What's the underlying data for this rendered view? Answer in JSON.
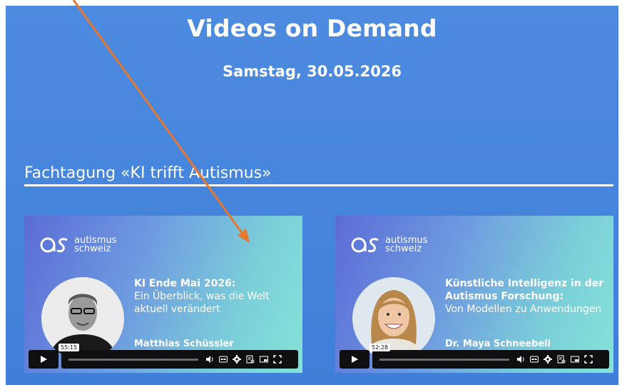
{
  "page": {
    "title": "Videos on Demand",
    "date": "Samstag, 30.05.2026",
    "section_title": "Fachtagung «KI trifft Autismus»"
  },
  "videos": [
    {
      "logo_line1": "autismus",
      "logo_line2": "schweiz",
      "headline": "KI Ende Mai 2026:",
      "subtitle_line1": "Ein Überblick, was die Welt",
      "subtitle_line2": "aktuell verändert",
      "speaker": "Matthias Schüssler",
      "duration": "55:15"
    },
    {
      "logo_line1": "autismus",
      "logo_line2": "schweiz",
      "headline_line1": "Künstliche Intelligenz in der",
      "headline_line2": "Autismus Forschung:",
      "subtitle_line1": "Von Modellen zu Anwendungen",
      "speaker": "Dr. Maya Schneebeli",
      "duration": "52:28"
    }
  ],
  "colors": {
    "background": "#4186dc",
    "annotation_arrow": "#e8772e"
  }
}
